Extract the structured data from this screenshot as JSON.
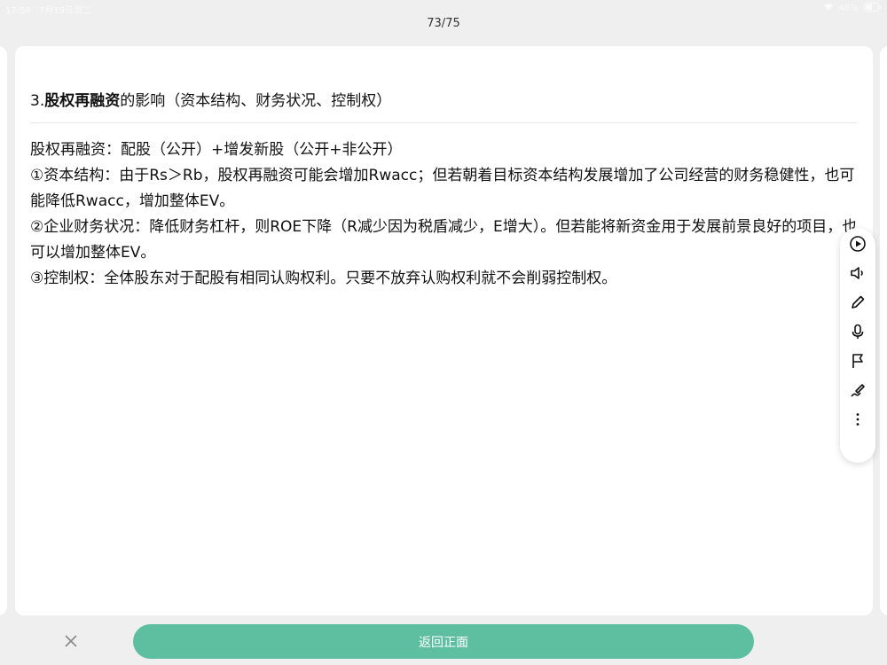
{
  "status_bar": {
    "time": "17:58",
    "date": "7月19日周二",
    "battery": "48%"
  },
  "page_counter": "73/75",
  "card": {
    "title_prefix": "3.",
    "title_bold": "股权再融资",
    "title_rest": "的影响（资本结构、财务状况、控制权）",
    "lines": [
      "股权再融资：配股（公开）+增发新股（公开+非公开）",
      "①资本结构：由于Rs＞Rb，股权再融资可能会增加Rwacc；但若朝着目标资本结构发展增加了公司经营的财务稳健性，也可能降低Rwacc，增加整体EV。",
      "②企业财务状况：降低财务杠杆，则ROE下降（R减少因为税盾减少，E增大）。但若能将新资金用于发展前景良好的项目，也可以增加整体EV。",
      "③控制权：全体股东对于配股有相同认购权利。只要不放弃认购权利就不会削弱控制权。"
    ]
  },
  "toolbar": {
    "icons": [
      "play-icon",
      "speaker-icon",
      "pencil-icon",
      "microphone-icon",
      "flag-icon",
      "pen-icon",
      "more-icon"
    ]
  },
  "bottom": {
    "back_label": "返回正面"
  },
  "colors": {
    "accent": "#5dbf9f",
    "background": "#efefef"
  }
}
